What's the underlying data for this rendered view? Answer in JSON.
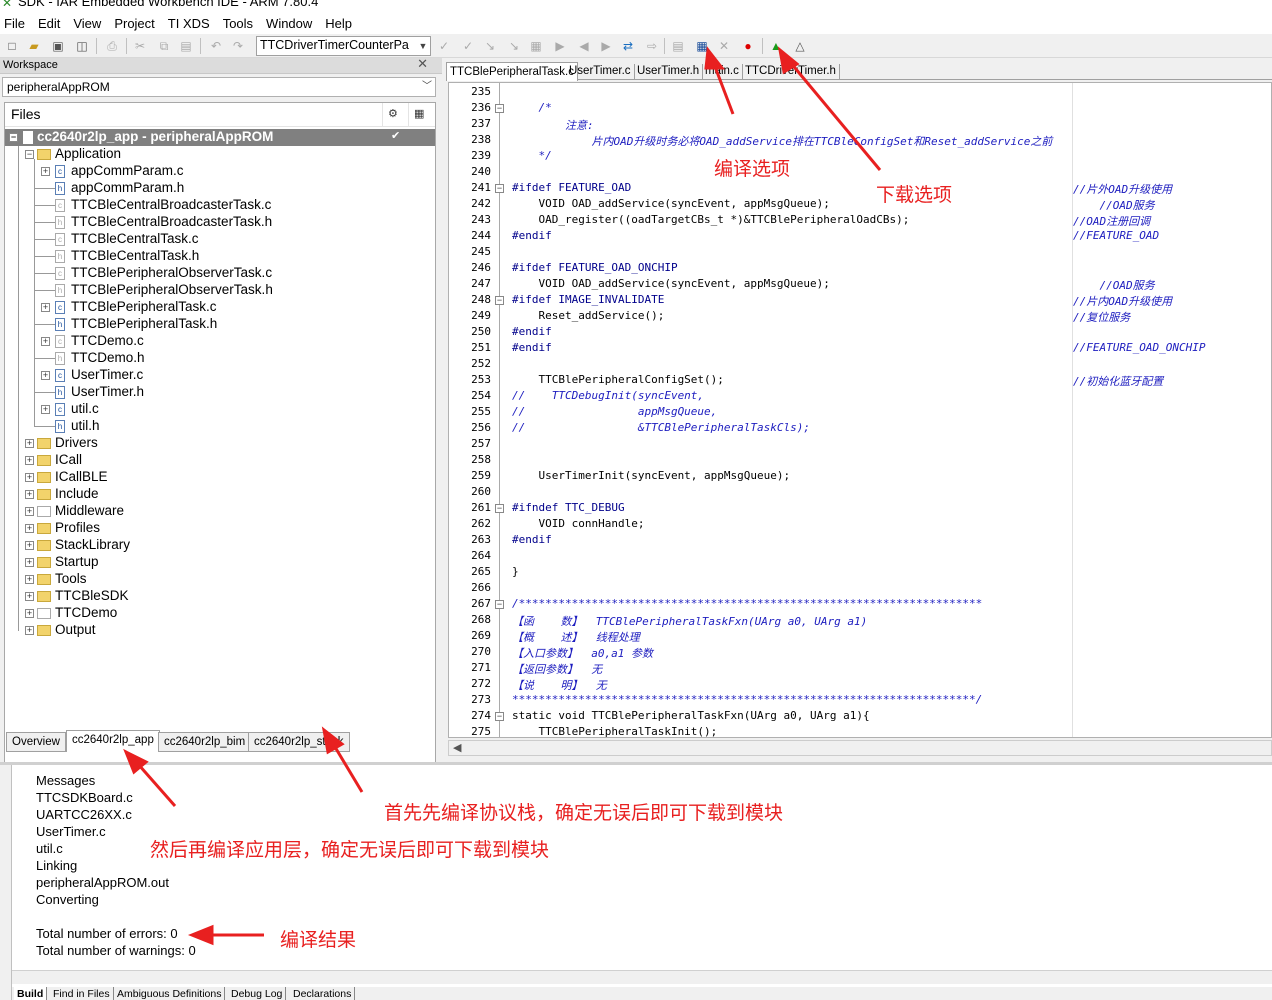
{
  "window": {
    "title": "SDK - IAR Embedded Workbench IDE - ARM 7.80.4"
  },
  "menu": [
    "File",
    "Edit",
    "View",
    "Project",
    "TI XDS",
    "Tools",
    "Window",
    "Help"
  ],
  "toolbar": {
    "config_value": "TTCDriverTimerCounterPa"
  },
  "workspace": {
    "header": "Workspace",
    "config": "peripheralAppROM",
    "files_header": "Files",
    "project": "cc2640r2lp_app - peripheralAppROM",
    "application": "Application",
    "app_files": [
      "appCommParam.c",
      "appCommParam.h",
      "TTCBleCentralBroadcasterTask.c",
      "TTCBleCentralBroadcasterTask.h",
      "TTCBleCentralTask.c",
      "TTCBleCentralTask.h",
      "TTCBlePeripheralObserverTask.c",
      "TTCBlePeripheralObserverTask.h",
      "TTCBlePeripheralTask.c",
      "TTCBlePeripheralTask.h",
      "TTCDemo.c",
      "TTCDemo.h",
      "UserTimer.c",
      "UserTimer.h",
      "util.c",
      "util.h"
    ],
    "groups": [
      "Drivers",
      "ICall",
      "ICallBLE",
      "Include",
      "Middleware",
      "Profiles",
      "StackLibrary",
      "Startup",
      "Tools",
      "TTCBleSDK",
      "TTCDemo",
      "Output"
    ],
    "tabs": [
      "Overview",
      "cc2640r2lp_app",
      "cc2640r2lp_bim",
      "cc2640r2lp_stack"
    ]
  },
  "editor": {
    "tabs": [
      "TTCBlePeripheralTask.c",
      "UserTimer.c",
      "UserTimer.h",
      "main.c",
      "TTCDriverTimer.h"
    ],
    "lines": [
      {
        "n": "235",
        "t": ""
      },
      {
        "n": "236",
        "t": "    /*"
      },
      {
        "n": "237",
        "t": "        注意:"
      },
      {
        "n": "238",
        "t": "            片内OAD升级时务必将OAD_addService排在TTCBleConfigSet和Reset_addService之前"
      },
      {
        "n": "239",
        "t": "    */"
      },
      {
        "n": "240",
        "t": ""
      },
      {
        "n": "241",
        "t": "#ifdef FEATURE_OAD",
        "r": "//片外OAD升级使用"
      },
      {
        "n": "242",
        "t": "    VOID OAD_addService(syncEvent, appMsgQueue);",
        "r": "    //OAD服务"
      },
      {
        "n": "243",
        "t": "    OAD_register((oadTargetCBs_t *)&TTCBlePeripheralOadCBs);",
        "r": "//OAD注册回调"
      },
      {
        "n": "244",
        "t": "#endif",
        "r": "//FEATURE_OAD"
      },
      {
        "n": "245",
        "t": ""
      },
      {
        "n": "246",
        "t": "#ifdef FEATURE_OAD_ONCHIP"
      },
      {
        "n": "247",
        "t": "    VOID OAD_addService(syncEvent, appMsgQueue);",
        "r": "    //OAD服务"
      },
      {
        "n": "248",
        "t": "#ifdef IMAGE_INVALIDATE",
        "r": "//片内OAD升级使用"
      },
      {
        "n": "249",
        "t": "    Reset_addService();",
        "r": "//复位服务"
      },
      {
        "n": "250",
        "t": "#endif"
      },
      {
        "n": "251",
        "t": "#endif",
        "r": "//FEATURE_OAD_ONCHIP"
      },
      {
        "n": "252",
        "t": ""
      },
      {
        "n": "253",
        "t": "    TTCBlePeripheralConfigSet();",
        "r": "//初始化蓝牙配置"
      },
      {
        "n": "254",
        "t": "//    TTCDebugInit(syncEvent,"
      },
      {
        "n": "255",
        "t": "//                 appMsgQueue,"
      },
      {
        "n": "256",
        "t": "//                 &TTCBlePeripheralTaskCls);"
      },
      {
        "n": "257",
        "t": ""
      },
      {
        "n": "258",
        "t": ""
      },
      {
        "n": "259",
        "t": "    UserTimerInit(syncEvent, appMsgQueue);"
      },
      {
        "n": "260",
        "t": ""
      },
      {
        "n": "261",
        "t": "#ifndef TTC_DEBUG"
      },
      {
        "n": "262",
        "t": "    VOID connHandle;"
      },
      {
        "n": "263",
        "t": "#endif"
      },
      {
        "n": "264",
        "t": ""
      },
      {
        "n": "265",
        "t": "}"
      },
      {
        "n": "266",
        "t": ""
      },
      {
        "n": "267",
        "t": "/**********************************************************************"
      },
      {
        "n": "268",
        "t": "【函    数】  TTCBlePeripheralTaskFxn(UArg a0, UArg a1)"
      },
      {
        "n": "269",
        "t": "【概    述】  线程处理"
      },
      {
        "n": "270",
        "t": "【入口参数】  a0,a1 参数"
      },
      {
        "n": "271",
        "t": "【返回参数】  无"
      },
      {
        "n": "272",
        "t": "【说    明】  无"
      },
      {
        "n": "273",
        "t": "**********************************************************************/"
      },
      {
        "n": "274",
        "t": "static void TTCBlePeripheralTaskFxn(UArg a0, UArg a1){"
      },
      {
        "n": "275",
        "t": "    TTCBlePeripheralTaskInit();"
      }
    ]
  },
  "messages": {
    "lines": [
      "Messages",
      "TTCSDKBoard.c",
      "UARTCC26XX.c",
      "UserTimer.c",
      "util.c",
      "Linking",
      "peripheralAppROM.out",
      "Converting",
      "",
      "Total number of errors: 0",
      "Total number of warnings: 0"
    ],
    "tabs": [
      "Build",
      "Find in Files",
      "Ambiguous Definitions",
      "Debug Log",
      "Declarations"
    ]
  },
  "annotations": {
    "compile_option": "编译选项",
    "download_option": "下载选项",
    "step1": "首先先编译协议栈，确定无误后即可下载到模块",
    "step2": "然后再编译应用层，确定无误后即可下载到模块",
    "result": "编译结果",
    "color": "#e82020"
  }
}
